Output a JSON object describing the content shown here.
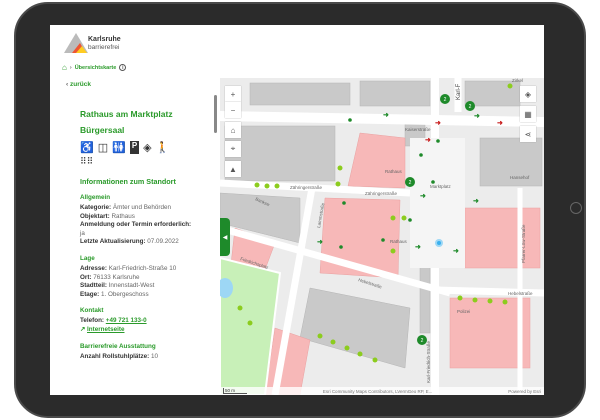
{
  "brand": {
    "line1": "Karlsruhe",
    "line2": "barrierefrei"
  },
  "breadcrumb": {
    "current": "Übersichtskarte"
  },
  "back_label": "zurück",
  "place": {
    "title": "Rathaus am Marktplatz",
    "subtitle": "Bürgersaal"
  },
  "feature_icons": [
    "wheelchair-icon",
    "elevator-icon",
    "toilet-icon",
    "parking-icon",
    "low-vision-icon",
    "blind-cane-icon",
    "braille-icon"
  ],
  "info_heading": "Informationen zum Standort",
  "general": {
    "heading": "Allgemein",
    "kategorie_label": "Kategorie:",
    "kategorie": "Ämter und Behörden",
    "objektart_label": "Objektart:",
    "objektart": "Rathaus",
    "anmeldung_label": "Anmeldung oder Termin erforderlich:",
    "anmeldung": "ja",
    "update_label": "Letzte Aktualisierung:",
    "update": "07.09.2022"
  },
  "location": {
    "heading": "Lage",
    "adresse_label": "Adresse:",
    "adresse": "Karl-Friedrich-Straße 10",
    "ort_label": "Ort:",
    "ort": "76133 Karlsruhe",
    "stadtteil_label": "Stadtteil:",
    "stadtteil": "Innenstadt-West",
    "etage_label": "Etage:",
    "etage": "1. Obergeschoss"
  },
  "contact": {
    "heading": "Kontakt",
    "telefon_label": "Telefon:",
    "telefon": "+49 721 133-0",
    "website": "Internetseite"
  },
  "equipment": {
    "heading": "Barrierefreie Ausstattung",
    "rollstuhl_label": "Anzahl Rollstuhlplätze:",
    "rollstuhl": "10"
  },
  "map": {
    "labels": [
      "Kaiserstraße",
      "Rathaus",
      "Marktplatz",
      "Hansehof",
      "Zähringerstraße",
      "Zähringerstraße",
      "Lammstraße",
      "Rathaus",
      "Friedrichsplatz",
      "Hebelstraße",
      "Hebelstraße",
      "Karl-Friedrich-Straße",
      "Pfarrer-Löw-Straße",
      "Zirkel",
      "Karl-F",
      "Polizei",
      "Bankstr"
    ],
    "cluster_count": "2",
    "scale": "50 m",
    "attribution": "Esri Community Maps Contributors, LVermGeo RP, E...",
    "powered": "Powered by Esri",
    "colors": {
      "accent": "#2a9a2a",
      "building": "#c8c8c8",
      "public_building": "#f7b8b8",
      "park": "#c8f0b8",
      "entrance_ok": "#1e8a2a",
      "entrance_bad": "#c81e1e"
    }
  }
}
